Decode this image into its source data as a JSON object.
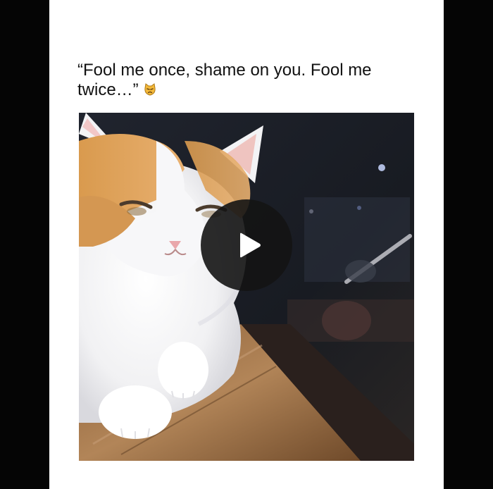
{
  "post": {
    "caption": "“Fool me once, shame on you. Fool me twice…”",
    "caption_emoji_icon": "pouting-cat-icon"
  },
  "video": {
    "play_icon": "play-icon",
    "state": "paused"
  },
  "colors": {
    "page_background": "#050505",
    "card_background": "#ffffff",
    "caption_text": "#111111",
    "play_button_bg": "#141414",
    "play_icon": "#ffffff"
  }
}
